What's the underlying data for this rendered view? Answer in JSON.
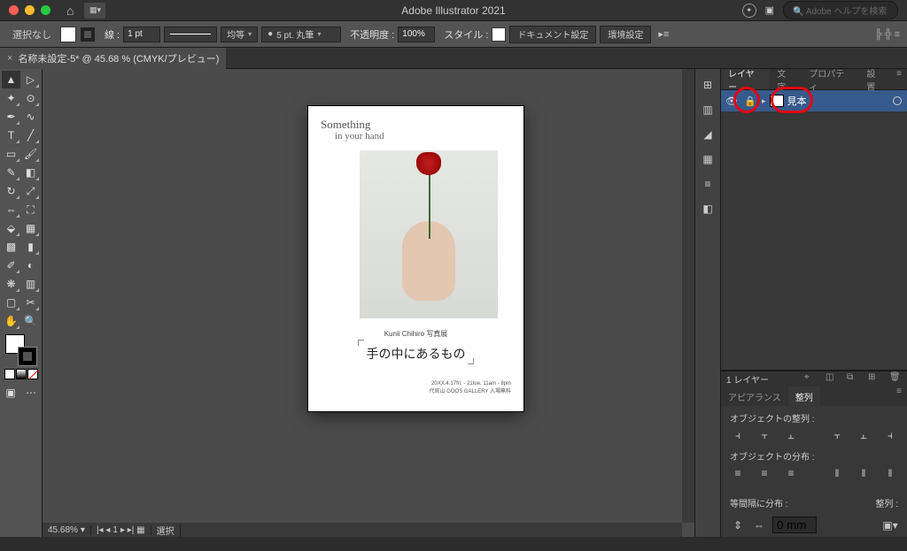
{
  "titlebar": {
    "app_title": "Adobe Illustrator 2021",
    "search_placeholder": "Adobe ヘルプを検索"
  },
  "controlbar": {
    "selection": "選択なし",
    "stroke_label": "線 :",
    "stroke_weight": "1 pt",
    "stroke_type": "均等",
    "brush": "5 pt. 丸筆",
    "opacity_label": "不透明度 :",
    "opacity_value": "100%",
    "style_label": "スタイル :",
    "doc_setup": "ドキュメント設定",
    "prefs": "環境設定"
  },
  "document_tab": {
    "name": "名称未設定-5* @ 45.68 % (CMYK/プレビュー)"
  },
  "artboard": {
    "script1": "Something",
    "script2": "in your hand",
    "subtitle": "Kunii Chihiro 写真展",
    "title": "手の中にあるもの",
    "info1": "20XX.4.17fri. - 21tue.  11am - 8pm",
    "info2": "代官山 GOOS GALLERY 入場無料"
  },
  "statusbar": {
    "zoom": "45.68%",
    "artboard_num": "1",
    "tool": "選択"
  },
  "panels": {
    "tabs": {
      "layers": "レイヤー",
      "text": "文字",
      "properties": "プロパティ",
      "links": "設置"
    },
    "layer": {
      "name": "見本"
    },
    "layer_footer": "1 レイヤー",
    "appearance_tab": "アピアランス",
    "align_tab": "整列",
    "align_obj": "オブジェクトの整列 :",
    "distribute_obj": "オブジェクトの分布 :",
    "spacing": "等間隔に分布 :",
    "align_to": "整列 :",
    "spacing_val": "0 mm"
  }
}
